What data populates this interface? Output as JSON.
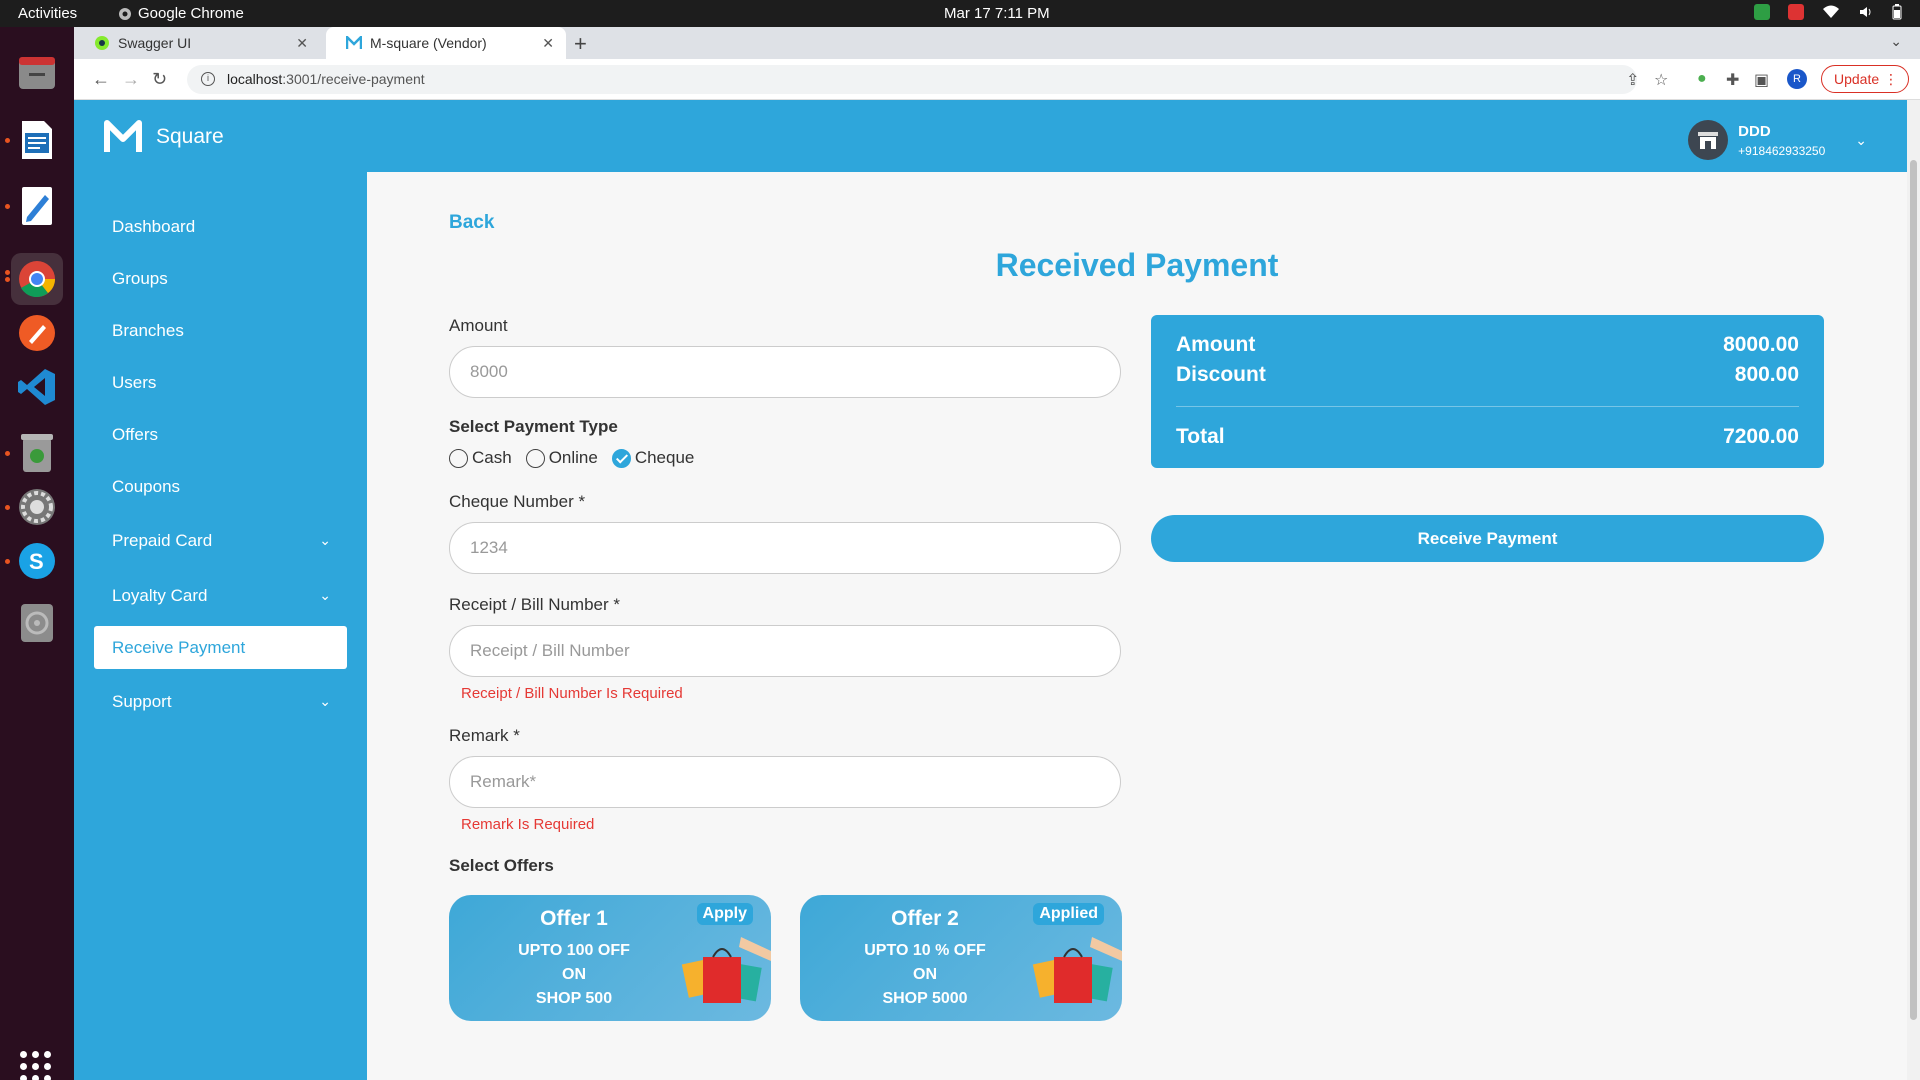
{
  "os": {
    "activities": "Activities",
    "app_name": "Google Chrome",
    "clock": "Mar 17  7:11 PM"
  },
  "browser": {
    "tabs": [
      {
        "title": "Swagger UI",
        "active": false
      },
      {
        "title": "M-square (Vendor)",
        "active": true
      }
    ],
    "url_host": "localhost",
    "url_rest": ":3001/receive-payment",
    "profile_initial": "R",
    "update_label": "Update"
  },
  "app": {
    "brand": "Square",
    "user_name": "DDD",
    "user_phone": "+918462933250"
  },
  "sidebar": {
    "items": [
      {
        "label": "Dashboard"
      },
      {
        "label": "Groups"
      },
      {
        "label": "Branches"
      },
      {
        "label": "Users"
      },
      {
        "label": "Offers"
      },
      {
        "label": "Coupons"
      },
      {
        "label": "Prepaid Card"
      },
      {
        "label": "Loyalty Card"
      },
      {
        "label": "Receive Payment"
      },
      {
        "label": "Support"
      }
    ]
  },
  "page": {
    "back": "Back",
    "title": "Received Payment",
    "amount_label": "Amount",
    "amount_value": "8000",
    "payment_type_label": "Select Payment Type",
    "payment_types": [
      "Cash",
      "Online",
      "Cheque"
    ],
    "selected_payment_type": "Cheque",
    "cheque_label": "Cheque Number *",
    "cheque_value": "1234",
    "receipt_label": "Receipt / Bill Number *",
    "receipt_placeholder": "Receipt / Bill Number",
    "receipt_error": "Receipt / Bill Number Is Required",
    "remark_label": "Remark *",
    "remark_placeholder": "Remark*",
    "remark_error": "Remark Is Required",
    "offers_label": "Select Offers"
  },
  "summary": {
    "amount_label": "Amount",
    "amount_value": "8000.00",
    "discount_label": "Discount",
    "discount_value": "800.00",
    "total_label": "Total",
    "total_value": "7200.00",
    "receive_button": "Receive Payment"
  },
  "offers": [
    {
      "title": "Offer 1",
      "line1": "UPTO 100 OFF",
      "line2": "ON",
      "line3": "SHOP 500",
      "action": "Apply"
    },
    {
      "title": "Offer 2",
      "line1": "UPTO 10 % OFF",
      "line2": "ON",
      "line3": "SHOP 5000",
      "action": "Applied"
    }
  ],
  "colors": {
    "accent": "#2ea6db",
    "error": "#e53935"
  }
}
